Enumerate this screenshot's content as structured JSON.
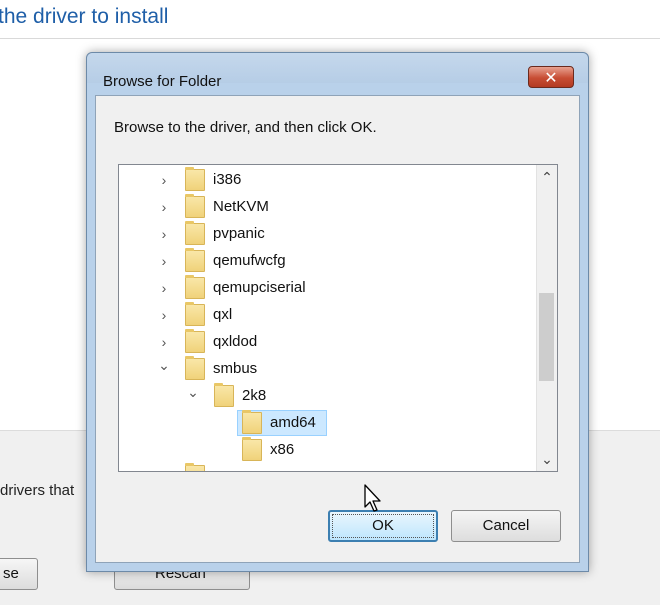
{
  "background": {
    "heading": "the driver to install",
    "description_fragment": "drivers that",
    "left_button_fragment": "se",
    "rescan_button": "Rescan"
  },
  "dialog": {
    "title": "Browse for Folder",
    "close_glyph": "✕",
    "prompt": "Browse to the driver, and then click OK.",
    "tree_items": [
      {
        "label": "i386",
        "expanded": false
      },
      {
        "label": "NetKVM",
        "expanded": false
      },
      {
        "label": "pvpanic",
        "expanded": false
      },
      {
        "label": "qemufwcfg",
        "expanded": false
      },
      {
        "label": "qemupciserial",
        "expanded": false
      },
      {
        "label": "qxl",
        "expanded": false
      },
      {
        "label": "qxldod",
        "expanded": false
      },
      {
        "label": "smbus",
        "expanded": true
      },
      {
        "label": "2k8",
        "expanded": true
      },
      {
        "label": "amd64",
        "selected": true
      },
      {
        "label": "x86"
      }
    ],
    "ok_button": "OK",
    "cancel_button": "Cancel"
  },
  "icons": {
    "collapsed": "›",
    "expanded": "⌄",
    "scroll_up": "⌃",
    "scroll_down": "⌄"
  }
}
